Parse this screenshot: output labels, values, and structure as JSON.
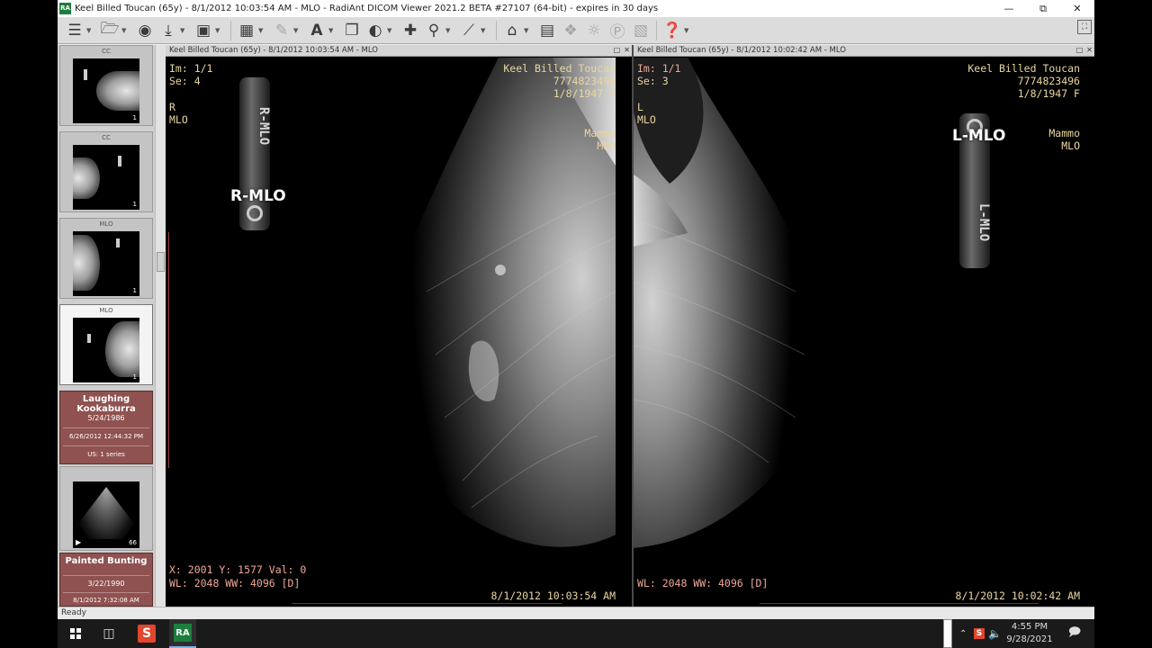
{
  "window": {
    "logo_text": "RA",
    "title": "Keel Billed Toucan (65y) - 8/1/2012 10:03:54 AM - MLO - RadiAnt DICOM Viewer 2021.2 BETA #27107 (64-bit) - expires in 30 days"
  },
  "sidebar": {
    "thumbnails": [
      {
        "label": "CC",
        "count": "1"
      },
      {
        "label": "CC",
        "count": "1"
      },
      {
        "label": "MLO",
        "count": "1"
      },
      {
        "label": "MLO",
        "count": "1"
      }
    ],
    "studies": [
      {
        "name": "Laughing Kookaburra",
        "birth_date": "5/24/1986",
        "datetime": "6/26/2012 12:44:32 PM",
        "series": "US: 1 series",
        "frames": "66"
      },
      {
        "name": "Painted Bunting",
        "birth_date": "3/22/1990",
        "datetime": "8/1/2012 7:32:08 AM"
      }
    ]
  },
  "viewports": [
    {
      "header": "Keel Billed Toucan (65y) - 8/1/2012 10:03:54 AM - MLO",
      "image": "Im: 1/1",
      "series": "Se: 4",
      "laterality": "R",
      "view": "MLO",
      "patient": "Keel Billed Toucan",
      "patient_id": "7774823496",
      "dob_sex": "1/8/1947 F",
      "modality": "Mammo",
      "view_right": "MLO",
      "cursor": "X: 2001 Y: 1577 Val: 0",
      "window_level": "WL: 2048 WW: 4096 [D]",
      "acquired": "8/1/2012 10:03:54 AM",
      "side_label": "R-MLO",
      "marker_text": "R-MLO"
    },
    {
      "header": "Keel Billed Toucan (65y) - 8/1/2012 10:02:42 AM - MLO",
      "image": "Im: 1/1",
      "series": "Se: 3",
      "laterality": "L",
      "view": "MLO",
      "patient": "Keel Billed Toucan",
      "patient_id": "7774823496",
      "dob_sex": "1/8/1947 F",
      "modality": "Mammo",
      "view_right": "MLO",
      "window_level": "WL: 2048 WW: 4096 [D]",
      "acquired": "8/1/2012 10:02:42 AM",
      "side_label": "L-MLO",
      "marker_text": "L-MLO"
    }
  ],
  "status": "Ready",
  "taskbar": {
    "time": "4:55 PM",
    "date": "9/28/2021"
  }
}
